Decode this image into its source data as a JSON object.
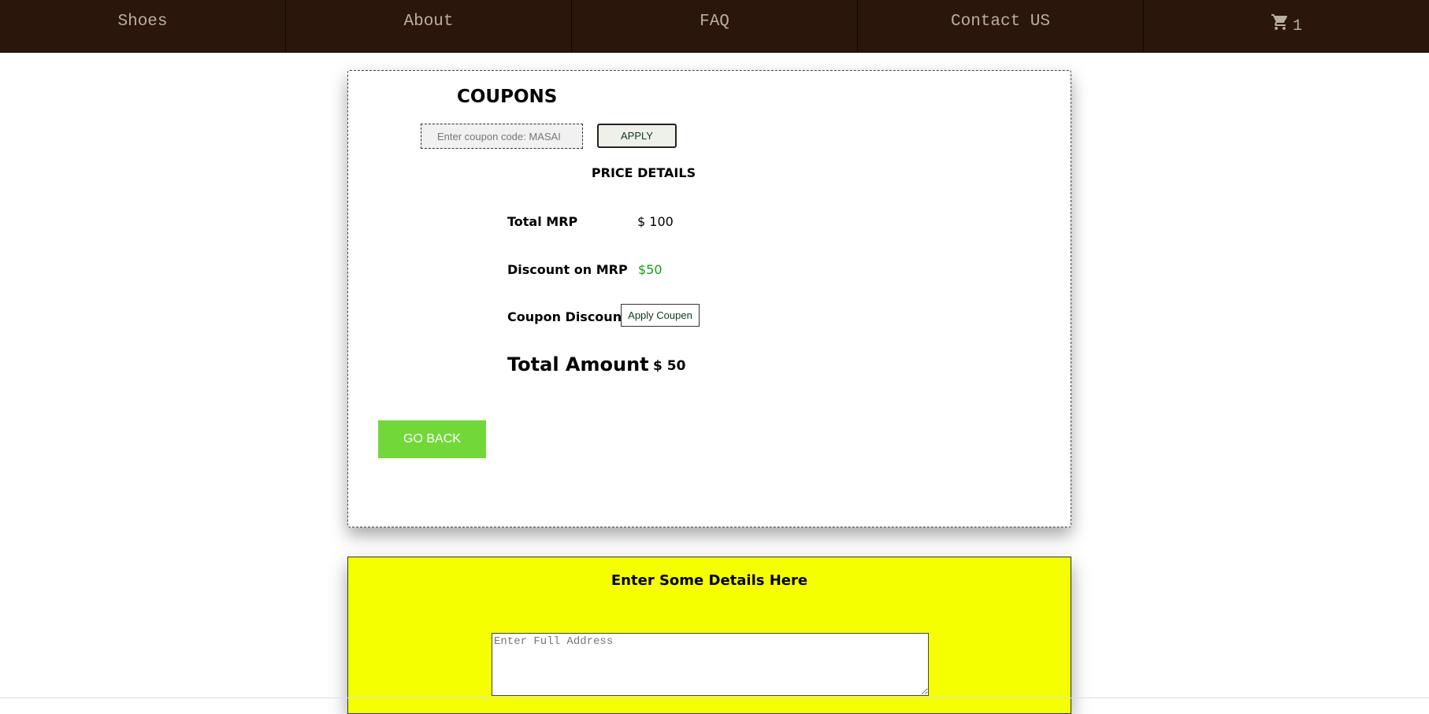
{
  "nav": {
    "items": [
      {
        "label": "Shoes"
      },
      {
        "label": "About"
      },
      {
        "label": "FAQ"
      },
      {
        "label": "Contact US"
      }
    ],
    "cart_count": "1",
    "cart_icon": "cart-icon"
  },
  "coupons": {
    "title": "COUPONS",
    "input_placeholder": "Enter coupon code: MASAI",
    "apply_label": "APPLY"
  },
  "price_details": {
    "title": "PRICE DETAILS",
    "total_mrp_label": "Total MRP",
    "total_mrp_value": "$ 100",
    "discount_label": "Discount on MRP",
    "discount_value": "$50",
    "discount_color": "#10a010",
    "coupon_discount_label": "Coupon Discount",
    "apply_coupon_label": "Apply Coupen",
    "total_amount_label": "Total Amount",
    "total_amount_value": "$ 50"
  },
  "go_back_label": "GO BACK",
  "details": {
    "title": "Enter Some Details Here",
    "address_placeholder": "Enter Full Address"
  },
  "colors": {
    "nav_bg": "#2a160a",
    "go_back_bg": "#72d83a",
    "details_bg": "#f5ff00"
  }
}
